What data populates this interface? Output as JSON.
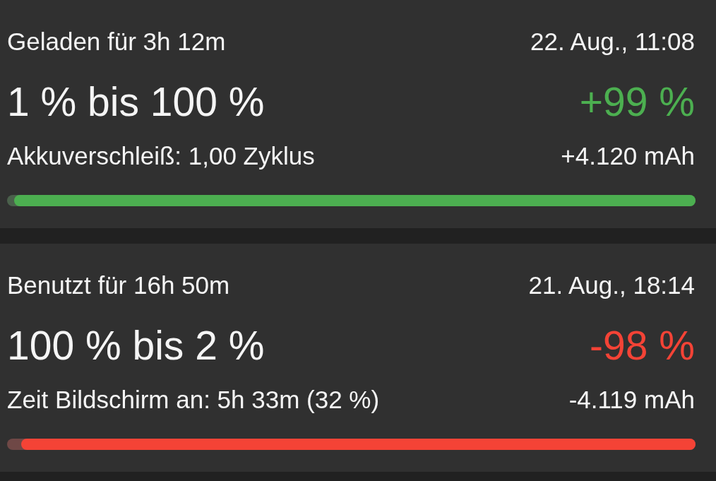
{
  "sessions": [
    {
      "duration": "Geladen für 3h 12m",
      "date": "22. Aug., 11:08",
      "range": "1 % bis 100 %",
      "change": "+99 %",
      "detail": "Akkuverschleiß: 1,00 Zyklus",
      "capacity": "+4.120 mAh",
      "color": "#4caf50",
      "level": 0.99
    },
    {
      "duration": "Benutzt für 16h 50m",
      "date": "21. Aug., 18:14",
      "range": "100 % bis 2 %",
      "change": "-98 %",
      "detail": "Zeit Bildschirm an: 5h 33m (32 %)",
      "capacity": "-4.119 mAh",
      "color": "#f44336",
      "level": 0.98
    }
  ]
}
